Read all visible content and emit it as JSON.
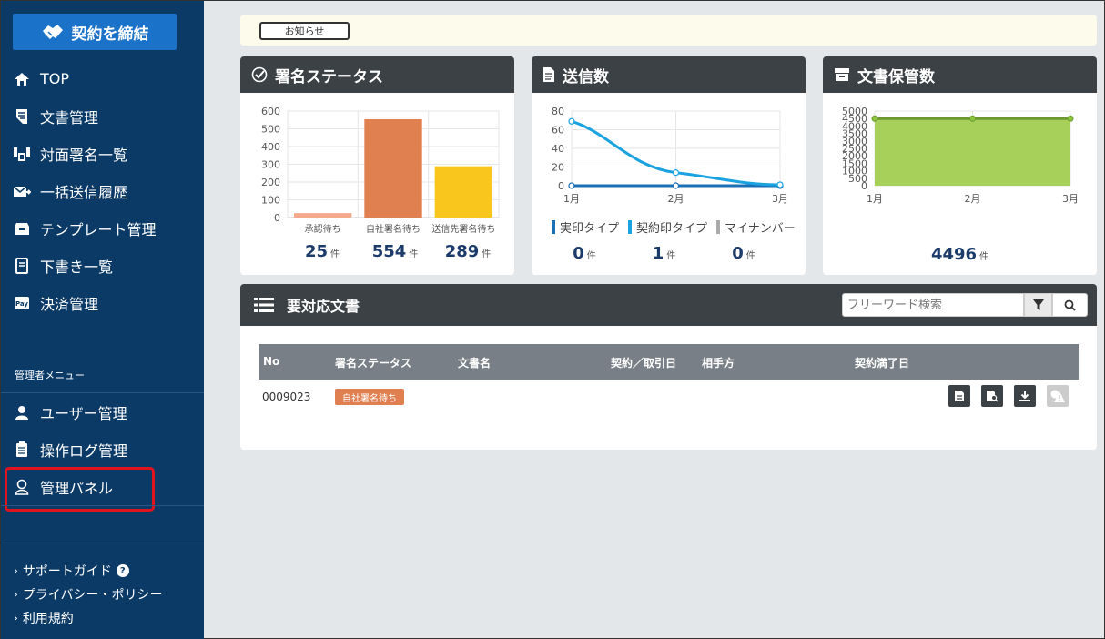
{
  "sidebar": {
    "cta_label": "契約を締結",
    "items": [
      {
        "label": "TOP",
        "icon": "home-icon"
      },
      {
        "label": "文書管理",
        "icon": "document-icon"
      },
      {
        "label": "対面署名一覧",
        "icon": "face-sign-icon"
      },
      {
        "label": "一括送信履歴",
        "icon": "bulk-send-icon"
      },
      {
        "label": "テンプレート管理",
        "icon": "template-icon"
      },
      {
        "label": "下書き一覧",
        "icon": "draft-icon"
      },
      {
        "label": "決済管理",
        "icon": "payment-icon"
      }
    ],
    "admin_label": "管理者メニュー",
    "admin_items": [
      {
        "label": "ユーザー管理",
        "icon": "user-icon"
      },
      {
        "label": "操作ログ管理",
        "icon": "log-icon"
      },
      {
        "label": "管理パネル",
        "icon": "admin-panel-icon"
      }
    ],
    "footer": {
      "support": "サポートガイド",
      "privacy": "プライバシー・ポリシー",
      "terms": "利用規約"
    }
  },
  "notice": {
    "button_label": "お知らせ"
  },
  "sign_status": {
    "title": "署名ステータス",
    "stats": [
      {
        "value": "25",
        "unit": "件"
      },
      {
        "value": "554",
        "unit": "件"
      },
      {
        "value": "289",
        "unit": "件"
      }
    ]
  },
  "send_count": {
    "title": "送信数",
    "legend": [
      "実印タイプ",
      "契約印タイプ",
      "マイナンバー"
    ],
    "stats": [
      {
        "value": "0",
        "unit": "件"
      },
      {
        "value": "1",
        "unit": "件"
      },
      {
        "value": "0",
        "unit": "件"
      }
    ]
  },
  "storage": {
    "title": "文書保管数",
    "stat": {
      "value": "4496",
      "unit": "件"
    }
  },
  "action_list": {
    "title": "要対応文書",
    "search_placeholder": "フリーワード検索",
    "columns": {
      "no": "No",
      "status": "署名ステータス",
      "name": "文書名",
      "date": "契約／取引日",
      "party": "相手方",
      "expiry": "契約満了日"
    },
    "rows": [
      {
        "no": "0009023",
        "status": "自社署名待ち"
      }
    ]
  },
  "colors": {
    "sidebar": "#0b3a66",
    "cta": "#1a73c9",
    "highlight": "#e0141e",
    "bar1": "#f4a98c",
    "bar2": "#e08050",
    "bar3": "#f9c61d",
    "line_jitsuin": "#1a6fb5",
    "line_keiyaku": "#1aa3e0",
    "line_mynumber": "#aaaaaa",
    "area": "#a7d05a"
  },
  "chart_data": [
    {
      "type": "bar",
      "categories": [
        "承認待ち",
        "自社署名待ち",
        "送信先署名待ち"
      ],
      "values": [
        25,
        554,
        289
      ],
      "ylim": [
        0,
        600
      ],
      "yticks": [
        0,
        100,
        200,
        300,
        400,
        500,
        600
      ],
      "grid": true
    },
    {
      "type": "line",
      "x": [
        "1月",
        "2月",
        "3月"
      ],
      "series": [
        {
          "name": "実印タイプ",
          "values": [
            0,
            0,
            0
          ]
        },
        {
          "name": "契約印タイプ",
          "values": [
            69,
            14,
            1
          ]
        },
        {
          "name": "マイナンバー",
          "values": [
            0,
            0,
            0
          ]
        }
      ],
      "ylim": [
        0,
        80
      ],
      "yticks": [
        0,
        20,
        40,
        60,
        80
      ],
      "grid": true,
      "legend": "bottom"
    },
    {
      "type": "area",
      "x": [
        "1月",
        "2月",
        "3月"
      ],
      "series": [
        {
          "values": [
            4496,
            4496,
            4496
          ]
        }
      ],
      "ylim": [
        0,
        5000
      ],
      "yticks": [
        0,
        500,
        1000,
        1500,
        2000,
        2500,
        3000,
        3500,
        4000,
        4500,
        5000
      ],
      "grid": true
    }
  ]
}
